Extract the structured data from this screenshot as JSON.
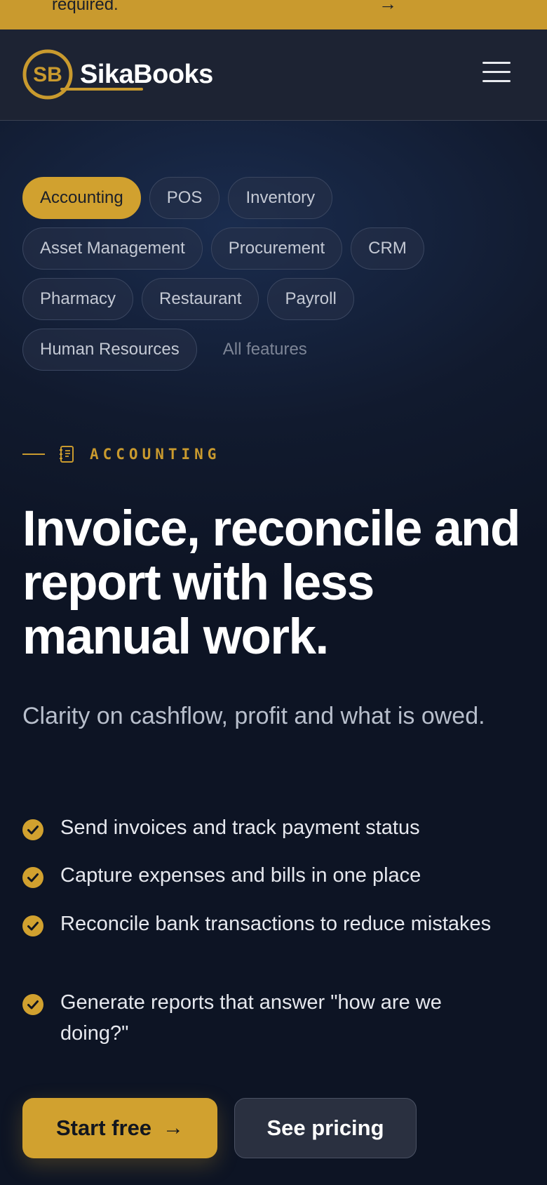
{
  "promo": {
    "text": "required.",
    "arrow": "→"
  },
  "header": {
    "brand_name": "SikaBooks",
    "brand_monogram": "SB",
    "menu_icon": "hamburger-menu-icon"
  },
  "colors": {
    "accent": "#c99a2e",
    "background": "#0e1525",
    "header": "#1d2333"
  },
  "feature_chips": [
    {
      "label": "Accounting",
      "active": true
    },
    {
      "label": "POS",
      "active": false
    },
    {
      "label": "Inventory",
      "active": false
    },
    {
      "label": "Asset Management",
      "active": false
    },
    {
      "label": "Procurement",
      "active": false
    },
    {
      "label": "CRM",
      "active": false
    },
    {
      "label": "Pharmacy",
      "active": false
    },
    {
      "label": "Restaurant",
      "active": false
    },
    {
      "label": "Payroll",
      "active": false
    },
    {
      "label": "Human Resources",
      "active": false
    },
    {
      "label": "All features",
      "active": false
    }
  ],
  "hero": {
    "eyebrow": "ACCOUNTING",
    "eyebrow_icon": "ledger-book-icon",
    "headline": "Invoice, reconcile and report with less manual work.",
    "subheadline": "Clarity on cashflow, profit and what is owed.",
    "features": [
      "Send invoices and track payment status",
      "Capture expenses and bills in one place",
      "Reconcile bank transactions to reduce mistakes",
      "Generate reports that answer \"how are we doing?\""
    ],
    "primary_cta": "Start free",
    "primary_cta_arrow": "→",
    "secondary_cta": "See pricing"
  }
}
